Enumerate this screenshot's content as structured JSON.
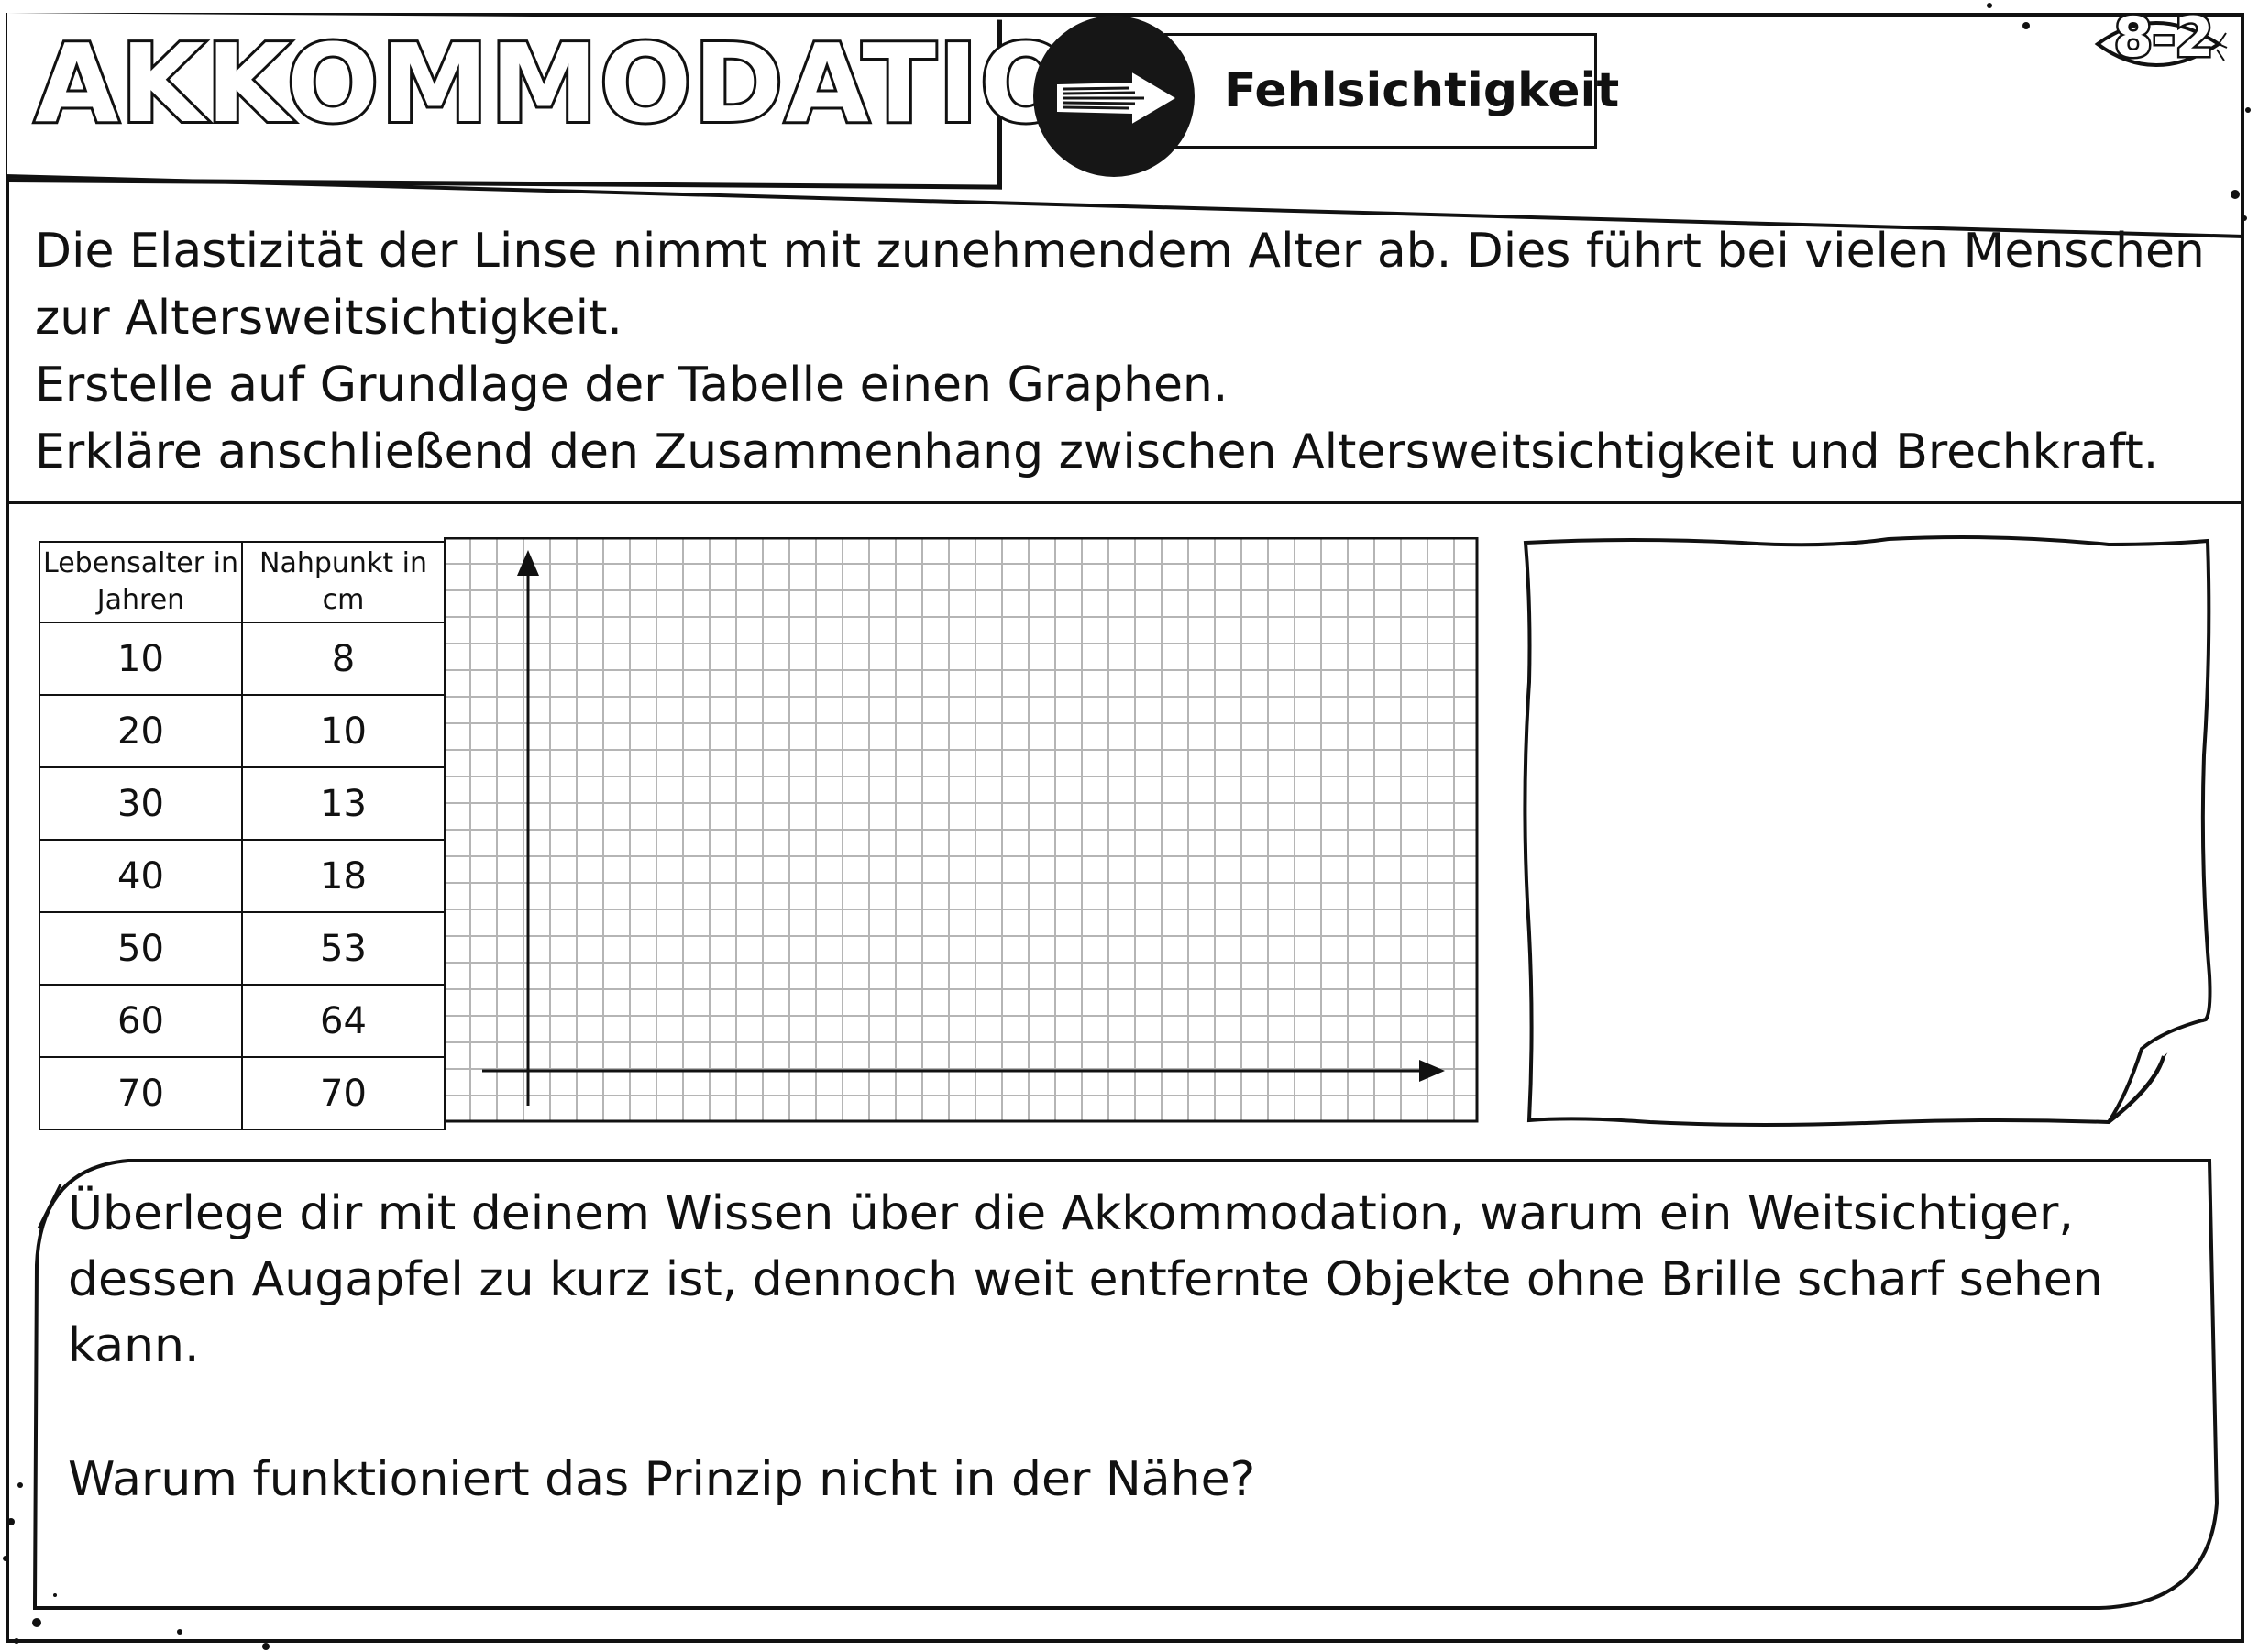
{
  "header": {
    "title": "AKKOMMODATION",
    "badge_label": "Fehlsichtigkeit",
    "page_number": "8-2"
  },
  "intro": {
    "lines": [
      "Die Elastizität der Linse nimmt mit zunehmendem Alter ab. Dies führt bei vielen Menschen zur Altersweitsichtigkeit.",
      "Erstelle auf Grundlage der Tabelle einen Graphen.",
      "Erkläre anschließend den Zusammenhang zwischen Altersweitsichtigkeit und Brechkraft."
    ]
  },
  "table": {
    "headers": [
      "Lebensalter in Jahren",
      "Nahpunkt in cm"
    ],
    "rows": [
      [
        "10",
        "8"
      ],
      [
        "20",
        "10"
      ],
      [
        "30",
        "13"
      ],
      [
        "40",
        "18"
      ],
      [
        "50",
        "53"
      ],
      [
        "60",
        "64"
      ],
      [
        "70",
        "70"
      ]
    ]
  },
  "questions": {
    "q1": "Überlege dir mit deinem Wissen über die Akkommodation, warum ein Weitsichtiger, dessen Augapfel zu kurz ist, dennoch weit entfernte Objekte ohne Brille scharf sehen kann.",
    "q2": "Warum funktioniert das Prinzip nicht in der Nähe?"
  },
  "colors": {
    "ink": "#111111",
    "grid": "#b5b5b5"
  }
}
